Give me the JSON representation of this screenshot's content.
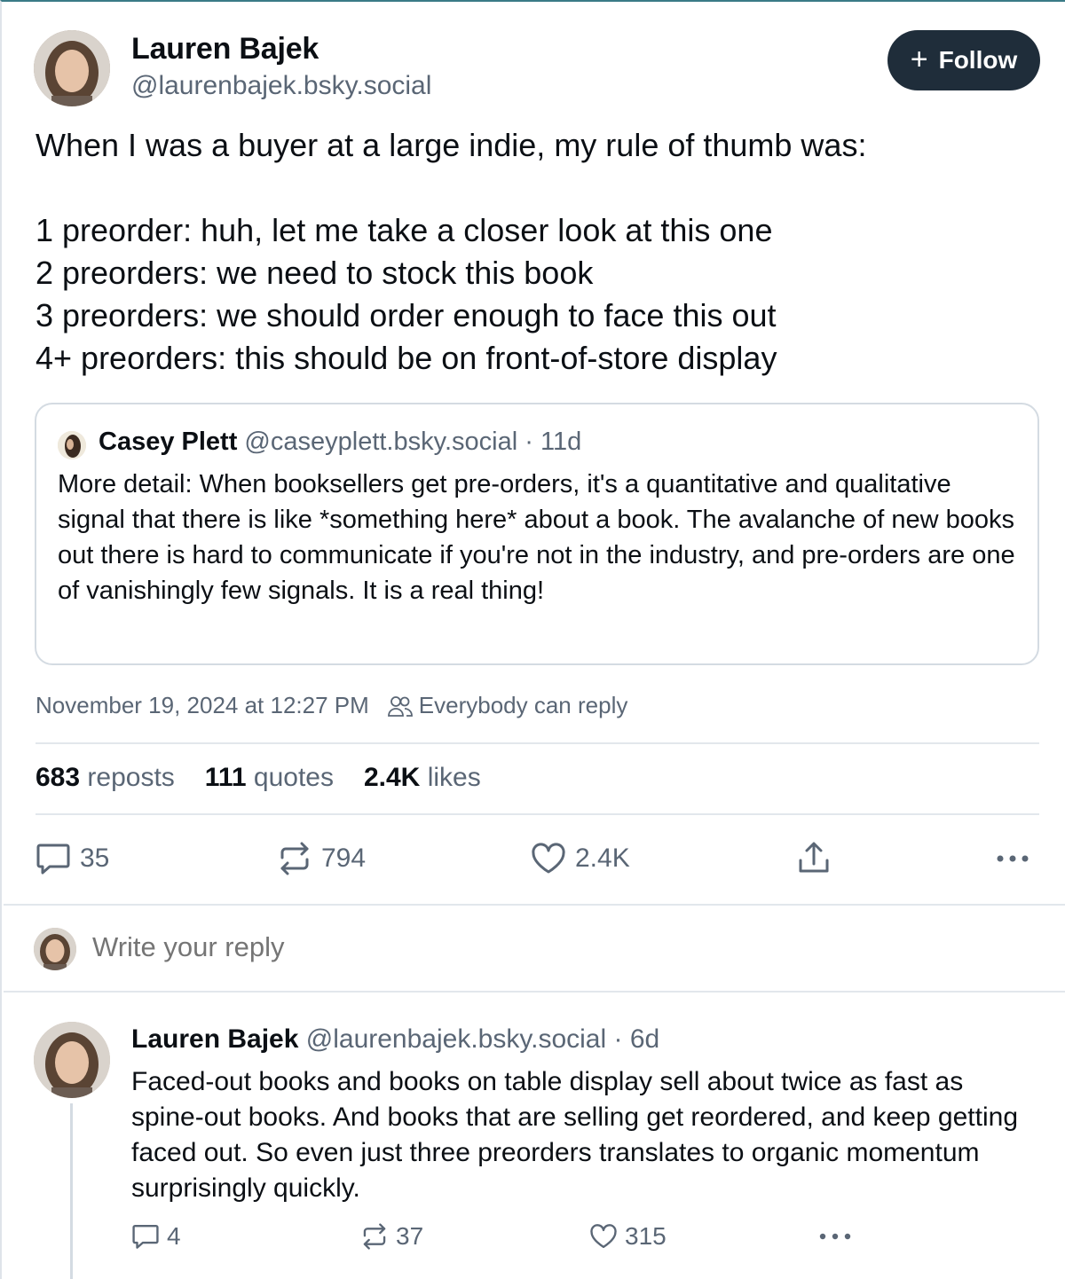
{
  "post": {
    "author_name": "Lauren Bajek",
    "author_handle": "@laurenbajek.bsky.social",
    "follow_label": "Follow",
    "text": "When I was a buyer at a large indie, my rule of thumb was:\n\n1 preorder: huh, let me take a closer look at this one\n2 preorders: we need to stock this book\n3 preorders: we should order enough to face this out\n4+ preorders: this should be on front-of-store display",
    "quote": {
      "author_name": "Casey Plett",
      "author_handle": "@caseyplett.bsky.social",
      "separator": "·",
      "age": "11d",
      "text": "More detail: When booksellers get pre-orders, it's a quantitative and qualitative signal that there is like *something here* about a book. The avalanche of new books out there is hard to communicate if you're not in the industry, and pre-orders are one of vanishingly few signals. It is a real thing!"
    },
    "timestamp": "November 19, 2024 at 12:27 PM",
    "reply_setting": "Everybody can reply",
    "stats": {
      "reposts_count": "683",
      "reposts_label": "reposts",
      "quotes_count": "111",
      "quotes_label": "quotes",
      "likes_count": "2.4K",
      "likes_label": "likes"
    },
    "actions": {
      "replies": "35",
      "reposts": "794",
      "likes": "2.4K"
    }
  },
  "reply_box": {
    "placeholder": "Write your reply"
  },
  "reply": {
    "author_name": "Lauren Bajek",
    "author_handle": "@laurenbajek.bsky.social",
    "separator": "·",
    "age": "6d",
    "text": "Faced-out books and books on table display sell about twice as fast as spine-out books. And books that are selling get reordered, and keep getting faced out. So even just three preorders translates to organic momentum surprisingly quickly.",
    "actions": {
      "replies": "4",
      "reposts": "37",
      "likes": "315"
    }
  },
  "icons": {
    "follow": "plus-icon",
    "reply_setting": "people-icon",
    "reply": "speech-bubble-icon",
    "repost": "repost-icon",
    "like": "heart-icon",
    "share": "share-icon",
    "more": "ellipsis-icon"
  },
  "colors": {
    "follow_button": "#1f2d3a",
    "text_primary": "#0b0f14",
    "text_secondary": "#5a6675",
    "border": "#d4dbe2"
  }
}
